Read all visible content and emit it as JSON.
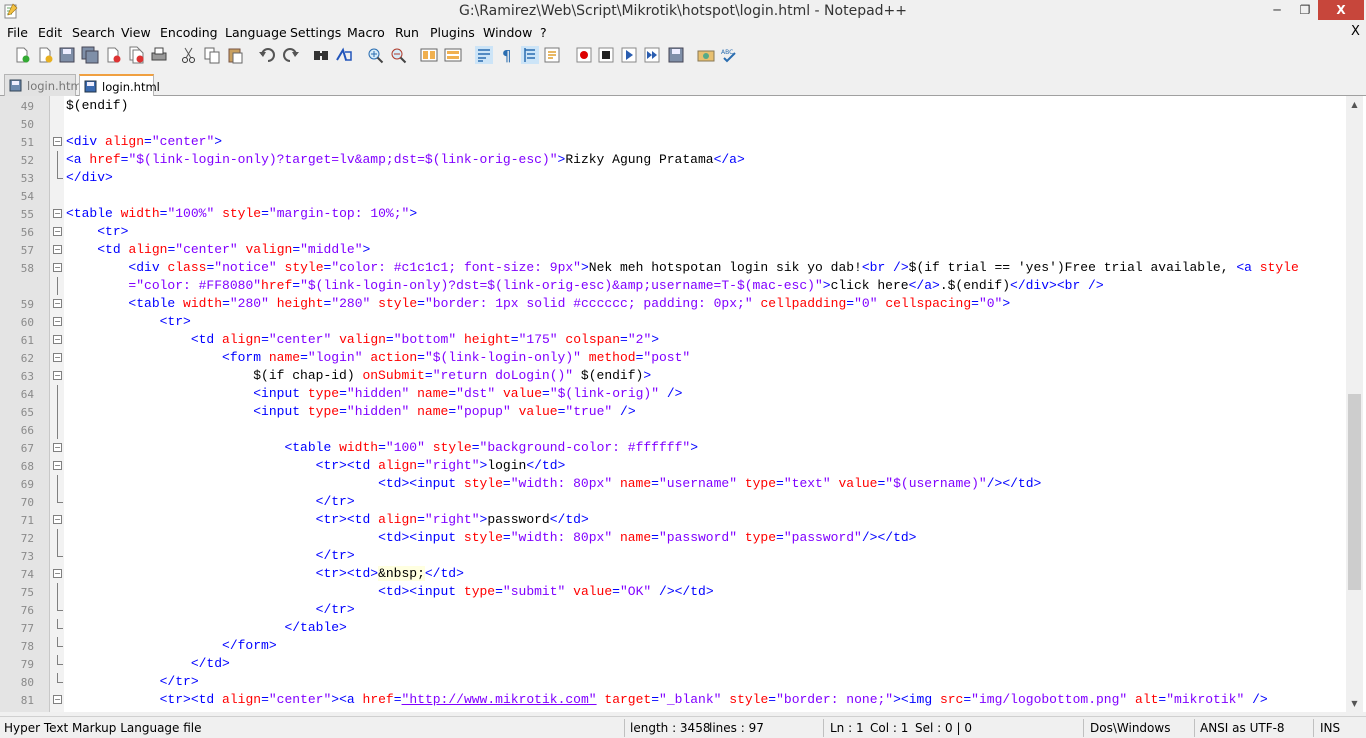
{
  "window": {
    "title": "G:\\Ramirez\\Web\\Script\\Mikrotik\\hotspot\\login.html - Notepad++",
    "min": "─",
    "max": "❐",
    "close": "X"
  },
  "menu": [
    "File",
    "Edit",
    "Search",
    "View",
    "Encoding",
    "Language",
    "Settings",
    "Macro",
    "Run",
    "Plugins",
    "Window",
    "?"
  ],
  "menu_close": "X",
  "toolbar_icons": [
    "new-file-icon",
    "open-file-icon",
    "save-icon",
    "save-all-icon",
    "close-icon",
    "close-all-icon",
    "print-icon",
    "cut-icon",
    "copy-icon",
    "paste-icon",
    "undo-icon",
    "redo-icon",
    "find-icon",
    "replace-icon",
    "zoom-in-icon",
    "zoom-out-icon",
    "sync-vertical-icon",
    "sync-horizontal-icon",
    "word-wrap-icon",
    "show-all-chars-icon",
    "indent-guide-icon",
    "function-list-icon",
    "record-macro-icon",
    "stop-record-icon",
    "play-macro-icon",
    "run-macro-multiple-icon",
    "save-macro-icon",
    "launch-browser-icon",
    "spell-check-icon"
  ],
  "tabs": [
    {
      "label": "login.html"
    },
    {
      "label": "login.html"
    }
  ],
  "lines": [
    {
      "n": "49",
      "fold": "",
      "html": "$(endif)"
    },
    {
      "n": "50",
      "fold": "",
      "html": ""
    },
    {
      "n": "51",
      "fold": "box",
      "html": "<span class='tg'>&lt;div</span> <span class='at'>align</span><span class='tg'>=</span><span class='vl'>\"center\"</span><span class='tg'>&gt;</span>"
    },
    {
      "n": "52",
      "fold": "line",
      "html": "<span class='tg'>&lt;a</span> <span class='at'>href</span><span class='tg'>=</span><span class='vl'>\"$(link-login-only)?target=lv&amp;amp;dst=$(link-orig-esc)\"</span><span class='tg'>&gt;</span>Rizky Agung Pratama<span class='tg'>&lt;/a&gt;</span>"
    },
    {
      "n": "53",
      "fold": "end",
      "html": "<span class='tg'>&lt;/div&gt;</span>"
    },
    {
      "n": "54",
      "fold": "",
      "html": ""
    },
    {
      "n": "55",
      "fold": "box",
      "html": "<span class='tg'>&lt;table</span> <span class='at'>width</span><span class='tg'>=</span><span class='vl'>\"100%\"</span> <span class='at'>style</span><span class='tg'>=</span><span class='vl'>\"margin-top: 10%;\"</span><span class='tg'>&gt;</span>"
    },
    {
      "n": "56",
      "fold": "box",
      "html": "    <span class='tg'>&lt;tr&gt;</span>"
    },
    {
      "n": "57",
      "fold": "box",
      "html": "    <span class='tg'>&lt;td</span> <span class='at'>align</span><span class='tg'>=</span><span class='vl'>\"center\"</span> <span class='at'>valign</span><span class='tg'>=</span><span class='vl'>\"middle\"</span><span class='tg'>&gt;</span>"
    },
    {
      "n": "58",
      "fold": "box",
      "html": "        <span class='tg'>&lt;div</span> <span class='at'>class</span><span class='tg'>=</span><span class='vl'>\"notice\"</span> <span class='at'>style</span><span class='tg'>=</span><span class='vl'>\"color: #c1c1c1; font-size: 9px\"</span><span class='tg'>&gt;</span>Nek meh hotspotan login sik yo dab!<span class='tg'>&lt;br /&gt;</span>$(if trial == 'yes')Free trial available, <span class='tg'>&lt;a</span> <span class='at'>style</span>"
    },
    {
      "n": "",
      "fold": "line",
      "html": "        <span class='vl'>=\"color: #FF8080\"</span><span class='at'>href</span><span class='tg'>=</span><span class='vl'>\"$(link-login-only)?dst=$(link-orig-esc)&amp;amp;username=T-$(mac-esc)\"</span><span class='tg'>&gt;</span>click here<span class='tg'>&lt;/a&gt;</span>.$(endif)<span class='tg'>&lt;/div&gt;&lt;br /&gt;</span>"
    },
    {
      "n": "59",
      "fold": "box",
      "html": "        <span class='tg'>&lt;table</span> <span class='at'>width</span><span class='tg'>=</span><span class='vl'>\"280\"</span> <span class='at'>height</span><span class='tg'>=</span><span class='vl'>\"280\"</span> <span class='at'>style</span><span class='tg'>=</span><span class='vl'>\"border: 1px solid #cccccc; padding: 0px;\"</span> <span class='at'>cellpadding</span><span class='tg'>=</span><span class='vl'>\"0\"</span> <span class='at'>cellspacing</span><span class='tg'>=</span><span class='vl'>\"0\"</span><span class='tg'>&gt;</span>"
    },
    {
      "n": "60",
      "fold": "box",
      "html": "            <span class='tg'>&lt;tr&gt;</span>"
    },
    {
      "n": "61",
      "fold": "box",
      "html": "                <span class='tg'>&lt;td</span> <span class='at'>align</span><span class='tg'>=</span><span class='vl'>\"center\"</span> <span class='at'>valign</span><span class='tg'>=</span><span class='vl'>\"bottom\"</span> <span class='at'>height</span><span class='tg'>=</span><span class='vl'>\"175\"</span> <span class='at'>colspan</span><span class='tg'>=</span><span class='vl'>\"2\"</span><span class='tg'>&gt;</span>"
    },
    {
      "n": "62",
      "fold": "box",
      "html": "                    <span class='tg'>&lt;form</span> <span class='at'>name</span><span class='tg'>=</span><span class='vl'>\"login\"</span> <span class='at'>action</span><span class='tg'>=</span><span class='vl'>\"$(link-login-only)\"</span> <span class='at'>method</span><span class='tg'>=</span><span class='vl'>\"post\"</span>"
    },
    {
      "n": "63",
      "fold": "box",
      "html": "                        $(if chap-id) <span class='at'>onSubmit</span><span class='tg'>=</span><span class='vl'>\"return doLogin()\"</span> $(endif)<span class='tg'>&gt;</span>"
    },
    {
      "n": "64",
      "fold": "line",
      "html": "                        <span class='tg'>&lt;input</span> <span class='at'>type</span><span class='tg'>=</span><span class='vl'>\"hidden\"</span> <span class='at'>name</span><span class='tg'>=</span><span class='vl'>\"dst\"</span> <span class='at'>value</span><span class='tg'>=</span><span class='vl'>\"$(link-orig)\"</span> <span class='tg'>/&gt;</span>"
    },
    {
      "n": "65",
      "fold": "line",
      "html": "                        <span class='tg'>&lt;input</span> <span class='at'>type</span><span class='tg'>=</span><span class='vl'>\"hidden\"</span> <span class='at'>name</span><span class='tg'>=</span><span class='vl'>\"popup\"</span> <span class='at'>value</span><span class='tg'>=</span><span class='vl'>\"true\"</span> <span class='tg'>/&gt;</span>"
    },
    {
      "n": "66",
      "fold": "line",
      "html": ""
    },
    {
      "n": "67",
      "fold": "box",
      "html": "                            <span class='tg'>&lt;table</span> <span class='at'>width</span><span class='tg'>=</span><span class='vl'>\"100\"</span> <span class='at'>style</span><span class='tg'>=</span><span class='vl'>\"background-color: #ffffff\"</span><span class='tg'>&gt;</span>"
    },
    {
      "n": "68",
      "fold": "box",
      "html": "                                <span class='tg'>&lt;tr&gt;&lt;td</span> <span class='at'>align</span><span class='tg'>=</span><span class='vl'>\"right\"</span><span class='tg'>&gt;</span>login<span class='tg'>&lt;/td&gt;</span>"
    },
    {
      "n": "69",
      "fold": "line",
      "html": "                                        <span class='tg'>&lt;td&gt;&lt;input</span> <span class='at'>style</span><span class='tg'>=</span><span class='vl'>\"width: 80px\"</span> <span class='at'>name</span><span class='tg'>=</span><span class='vl'>\"username\"</span> <span class='at'>type</span><span class='tg'>=</span><span class='vl'>\"text\"</span> <span class='at'>value</span><span class='tg'>=</span><span class='vl'>\"$(username)\"</span><span class='tg'>/&gt;&lt;/td&gt;</span>"
    },
    {
      "n": "70",
      "fold": "end",
      "html": "                                <span class='tg'>&lt;/tr&gt;</span>"
    },
    {
      "n": "71",
      "fold": "box",
      "html": "                                <span class='tg'>&lt;tr&gt;&lt;td</span> <span class='at'>align</span><span class='tg'>=</span><span class='vl'>\"right\"</span><span class='tg'>&gt;</span>password<span class='tg'>&lt;/td&gt;</span>"
    },
    {
      "n": "72",
      "fold": "line",
      "html": "                                        <span class='tg'>&lt;td&gt;&lt;input</span> <span class='at'>style</span><span class='tg'>=</span><span class='vl'>\"width: 80px\"</span> <span class='at'>name</span><span class='tg'>=</span><span class='vl'>\"password\"</span> <span class='at'>type</span><span class='tg'>=</span><span class='vl'>\"password\"</span><span class='tg'>/&gt;&lt;/td&gt;</span>"
    },
    {
      "n": "73",
      "fold": "end",
      "html": "                                <span class='tg'>&lt;/tr&gt;</span>"
    },
    {
      "n": "74",
      "fold": "box",
      "html": "                                <span class='tg'>&lt;tr&gt;&lt;td&gt;</span><span class='ent'>&amp;nbsp;</span><span class='tg'>&lt;/td&gt;</span>"
    },
    {
      "n": "75",
      "fold": "line",
      "html": "                                        <span class='tg'>&lt;td&gt;&lt;input</span> <span class='at'>type</span><span class='tg'>=</span><span class='vl'>\"submit\"</span> <span class='at'>value</span><span class='tg'>=</span><span class='vl'>\"OK\"</span> <span class='tg'>/&gt;&lt;/td&gt;</span>"
    },
    {
      "n": "76",
      "fold": "end",
      "html": "                                <span class='tg'>&lt;/tr&gt;</span>"
    },
    {
      "n": "77",
      "fold": "end",
      "html": "                            <span class='tg'>&lt;/table&gt;</span>"
    },
    {
      "n": "78",
      "fold": "end",
      "html": "                    <span class='tg'>&lt;/form&gt;</span>"
    },
    {
      "n": "79",
      "fold": "end",
      "html": "                <span class='tg'>&lt;/td&gt;</span>"
    },
    {
      "n": "80",
      "fold": "end",
      "html": "            <span class='tg'>&lt;/tr&gt;</span>"
    },
    {
      "n": "81",
      "fold": "box",
      "html": "            <span class='tg'>&lt;tr&gt;&lt;td</span> <span class='at'>align</span><span class='tg'>=</span><span class='vl'>\"center\"</span><span class='tg'>&gt;&lt;a</span> <span class='at'>href</span><span class='tg'>=</span><span class='ln2'>\"http://www.mikrotik.com\"</span> <span class='at'>target</span><span class='tg'>=</span><span class='vl'>\"_blank\"</span> <span class='at'>style</span><span class='tg'>=</span><span class='vl'>\"border: none;\"</span><span class='tg'>&gt;&lt;img</span> <span class='at'>src</span><span class='tg'>=</span><span class='vl'>\"img/logobottom.png\"</span> <span class='at'>alt</span><span class='tg'>=</span><span class='vl'>\"mikrotik\"</span> <span class='tg'>/&gt;</span>"
    }
  ],
  "status": {
    "filetype": "Hyper Text Markup Language file",
    "length": "length : 3458",
    "lines": "lines : 97",
    "ln": "Ln : 1",
    "col": "Col : 1",
    "sel": "Sel : 0 | 0",
    "eol": "Dos\\Windows",
    "encoding": "ANSI as UTF-8",
    "mode": "INS"
  }
}
